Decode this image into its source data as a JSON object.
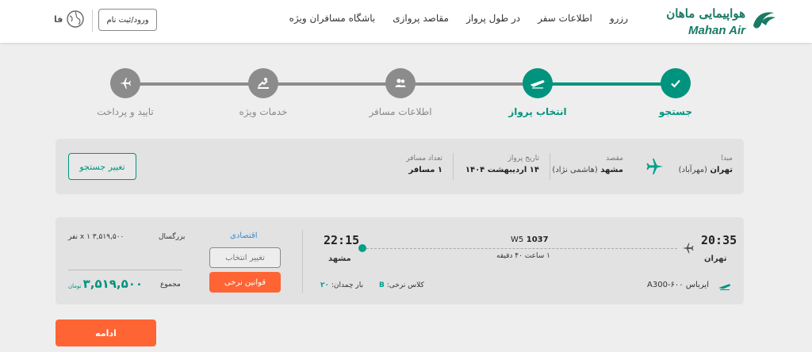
{
  "header": {
    "logo_fa": "هواپیمایی ماهان",
    "logo_en": "Mahan Air",
    "nav": [
      "رزرو",
      "اطلاعات سفر",
      "در طول پرواز",
      "مقاصد پروازی",
      "باشگاه مسافران ویژه"
    ],
    "login_label": "ورود/ثبت نام",
    "lang_label": "فا"
  },
  "steps": [
    {
      "label": "جستجو",
      "icon": "check-icon",
      "state": "done"
    },
    {
      "label": "انتخاب پرواز",
      "icon": "plane-departure-icon",
      "state": "active"
    },
    {
      "label": "اطلاعات مسافر",
      "icon": "users-icon",
      "state": "pending"
    },
    {
      "label": "خدمات ویژه",
      "icon": "service-icon",
      "state": "pending"
    },
    {
      "label": "تایید و پرداخت",
      "icon": "plane-icon",
      "state": "pending"
    }
  ],
  "search": {
    "origin_label": "مبدا",
    "origin_value": "تهران",
    "origin_sub": "(مهرآباد)",
    "dest_label": "مقصد",
    "dest_value": "مشهد",
    "dest_sub": "(هاشمی نژاد)",
    "date_label": "تاریخ پرواز",
    "date_value": "۱۴ اردیبهشت ۱۴۰۴",
    "pax_label": "تعداد مسافر",
    "pax_value": "۱ مسافر",
    "change_label": "تغییر جستجو"
  },
  "flight": {
    "dep_time": "20:35",
    "dep_city": "تهران",
    "arr_time": "22:15",
    "arr_city": "مشهد",
    "flight_prefix": "W5",
    "flight_number": "1037",
    "duration": "۱ ساعت ۴۰ دقیقه",
    "aircraft": "ایرباس ۶۰۰-A300",
    "fare_class_label": "کلاس نرخی:",
    "fare_class_value": "B",
    "baggage_label": "بار چمدان:",
    "baggage_value": "۲۰",
    "cabin_label": "اقتصادی",
    "change_select_label": "تغییر انتخاب",
    "rules_label": "قوانین نرخی",
    "adult_label": "بزرگسال",
    "adult_price": "۳,۵۱۹,۵۰۰ x ۱ نفر",
    "total_label": "مجموع",
    "total_value": "۳,۵۱۹,۵۰۰",
    "total_unit": "تومان"
  },
  "continue_label": "ادامه",
  "colors": {
    "teal": "#00947e",
    "orange": "#ff6434",
    "grey_step": "#8c8c8c",
    "blue_label": "#3a8fd6"
  }
}
